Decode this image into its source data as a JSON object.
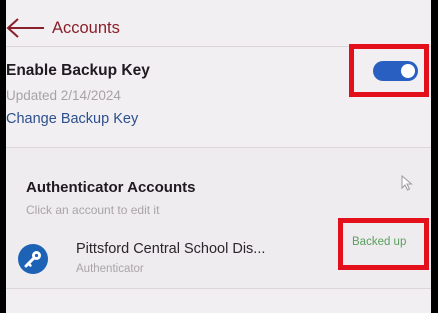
{
  "header": {
    "title": "Accounts",
    "back_icon": "arrow-left-icon"
  },
  "backup": {
    "enable_label": "Enable Backup Key",
    "updated_text": "Updated 2/14/2024",
    "change_link": "Change Backup Key",
    "toggle_on": true
  },
  "authenticator_accounts": {
    "title": "Authenticator Accounts",
    "subtitle": "Click an account to edit it",
    "items": [
      {
        "name": "Pittsford Central School Dis...",
        "type": "Authenticator",
        "status": "Backed up",
        "icon": "key-icon"
      }
    ]
  },
  "colors": {
    "accent": "#8a1f2c",
    "link": "#2c4f8e",
    "toggle": "#2a5fc2",
    "status_ok": "#5a9f5e",
    "highlight": "#e3101c"
  }
}
